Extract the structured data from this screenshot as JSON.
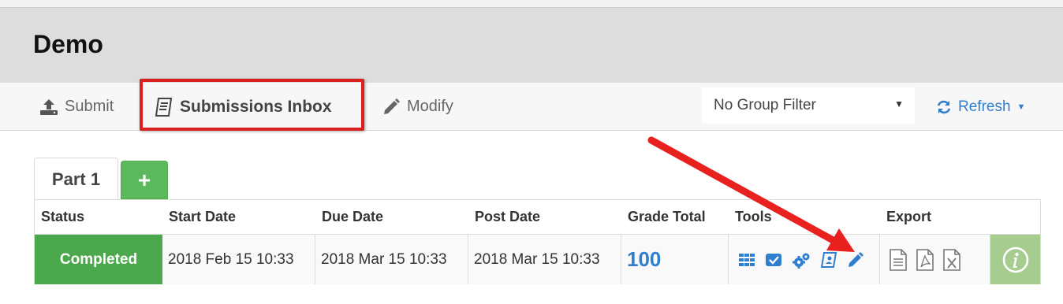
{
  "page": {
    "title": "Demo"
  },
  "toolbar": {
    "submit_label": "Submit",
    "inbox_label": "Submissions Inbox",
    "modify_label": "Modify",
    "group_filter_value": "No Group Filter",
    "refresh_label": "Refresh"
  },
  "tabs": {
    "active_label": "Part 1",
    "add_label": "+"
  },
  "table": {
    "headers": [
      "Status",
      "Start Date",
      "Due Date",
      "Post Date",
      "Grade Total",
      "Tools",
      "Export"
    ],
    "row": {
      "status": "Completed",
      "start_date": "2018 Feb 15 10:33",
      "due_date": "2018 Mar 15 10:33",
      "post_date": "2018 Mar 15 10:33",
      "grade_total": "100"
    },
    "tool_icons": [
      "grid-icon",
      "check-square-icon",
      "gears-icon",
      "contact-card-icon",
      "pencil-icon"
    ],
    "export_icons": [
      "text-file-icon",
      "pdf-file-icon",
      "excel-file-icon"
    ]
  },
  "colors": {
    "accent": "#2f7fd0",
    "status_green": "#4ca84c",
    "add_tab_green": "#5cb85c",
    "annotation_red": "#d9201f",
    "info_green": "#a6cc8f"
  }
}
